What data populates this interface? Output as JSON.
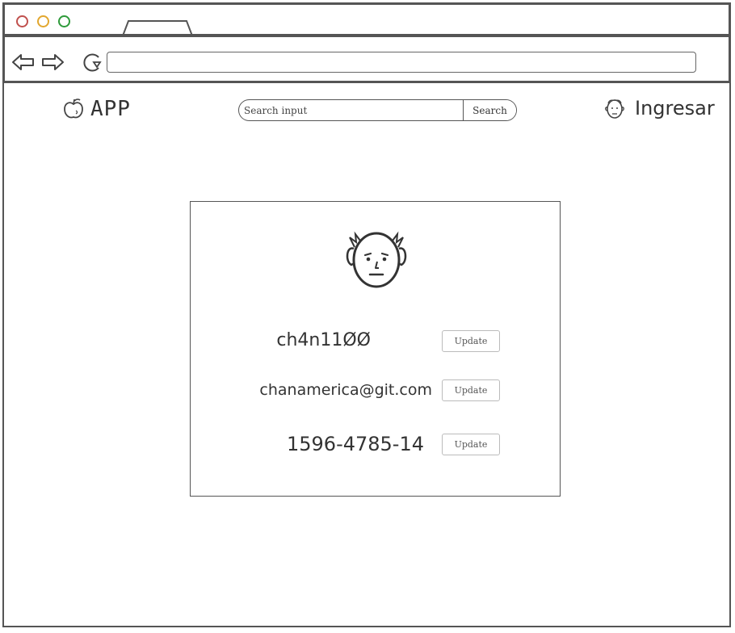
{
  "browser": {
    "window_controls": [
      "close",
      "minimize",
      "maximize"
    ],
    "address_bar_value": ""
  },
  "header": {
    "logo_icon": "apple-icon",
    "logo_text": "APP",
    "search": {
      "placeholder": "Search input",
      "button_label": "Search"
    },
    "login": {
      "icon": "user-face-icon",
      "label": "Ingresar"
    }
  },
  "profile": {
    "avatar_icon": "user-face-icon",
    "fields": [
      {
        "value": "ch4n11ØØ",
        "button_label": "Update"
      },
      {
        "value": "chanamerica@git.com",
        "button_label": "Update"
      },
      {
        "value": "1596-4785-14",
        "button_label": "Update"
      }
    ]
  },
  "colors": {
    "close": "#c0504d",
    "minimize": "#e2a72e",
    "maximize": "#2e9a3a",
    "frame": "#555555"
  }
}
